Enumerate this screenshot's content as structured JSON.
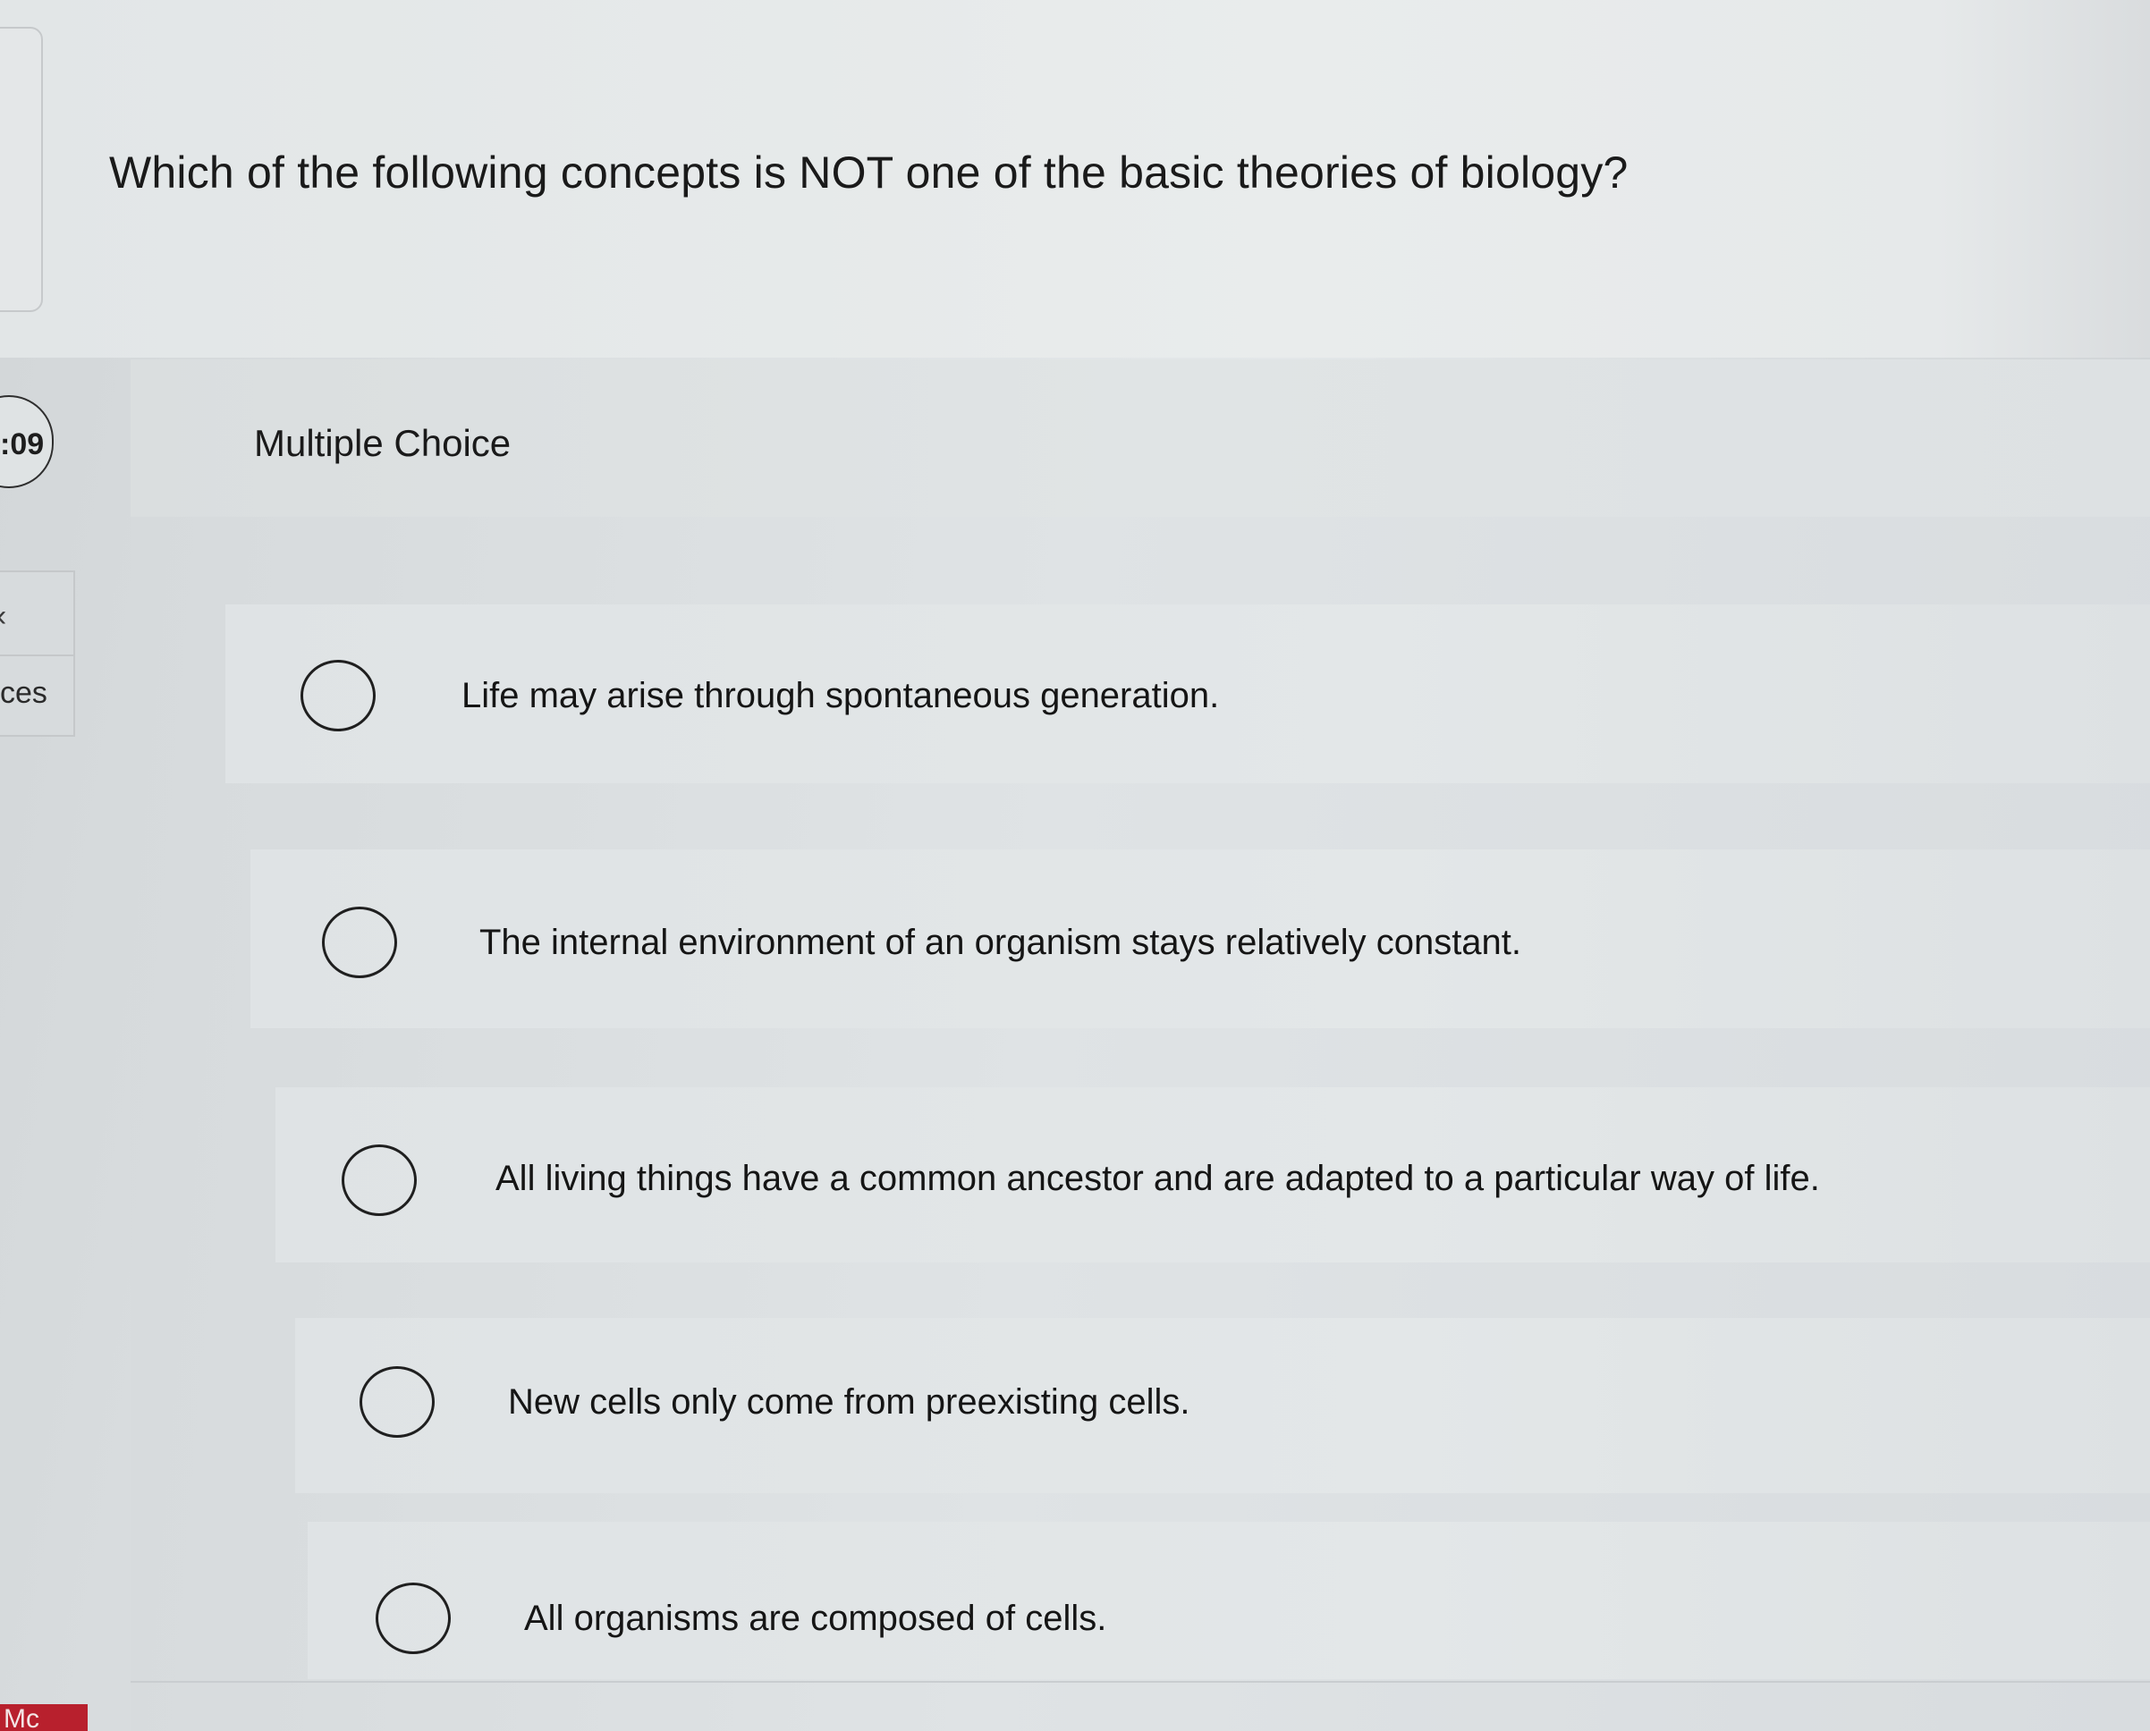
{
  "question": {
    "text": "Which of the following concepts is NOT one of the basic theories of biology?"
  },
  "sidebar": {
    "timer": ":09",
    "chevron": "‹",
    "label": "ces",
    "brand": "Mc"
  },
  "section": {
    "label": "Multiple Choice"
  },
  "options": [
    {
      "label": "Life may arise through spontaneous generation."
    },
    {
      "label": "The internal environment of an organism stays relatively constant."
    },
    {
      "label": "All living things have a common ancestor and are adapted to a particular way of life."
    },
    {
      "label": "New cells only come from preexisting cells."
    },
    {
      "label": "All organisms are composed of cells."
    }
  ]
}
